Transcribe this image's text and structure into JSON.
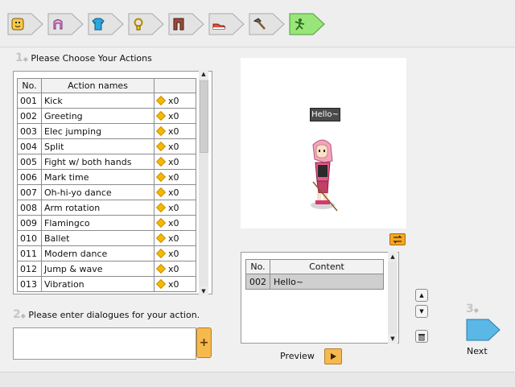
{
  "tabs": [
    {
      "icon": "face-icon"
    },
    {
      "icon": "hair-icon"
    },
    {
      "icon": "shirt-icon"
    },
    {
      "icon": "necklace-icon"
    },
    {
      "icon": "pants-icon"
    },
    {
      "icon": "shoe-icon"
    },
    {
      "icon": "hammer-icon"
    },
    {
      "icon": "dance-icon",
      "active": true
    }
  ],
  "step1": {
    "num": "1",
    "label": "Please Choose Your Actions"
  },
  "actions_table": {
    "headers": [
      "No.",
      "Action names",
      ""
    ],
    "rows": [
      {
        "no": "001",
        "name": "Kick",
        "cost": "x0"
      },
      {
        "no": "002",
        "name": "Greeting",
        "cost": "x0"
      },
      {
        "no": "003",
        "name": "Elec jumping",
        "cost": "x0"
      },
      {
        "no": "004",
        "name": "Split",
        "cost": "x0"
      },
      {
        "no": "005",
        "name": "Fight w/ both hands",
        "cost": "x0"
      },
      {
        "no": "006",
        "name": "Mark time",
        "cost": "x0"
      },
      {
        "no": "007",
        "name": "Oh-hi-yo dance",
        "cost": "x0"
      },
      {
        "no": "008",
        "name": "Arm rotation",
        "cost": "x0"
      },
      {
        "no": "009",
        "name": "Flamingco",
        "cost": "x0"
      },
      {
        "no": "010",
        "name": "Ballet",
        "cost": "x0"
      },
      {
        "no": "011",
        "name": "Modern dance",
        "cost": "x0"
      },
      {
        "no": "012",
        "name": "Jump & wave",
        "cost": "x0"
      },
      {
        "no": "013",
        "name": "Vibration",
        "cost": "x0"
      }
    ]
  },
  "step2": {
    "num": "2",
    "label": "Please enter dialogues for your action."
  },
  "dialog_input": {
    "value": "",
    "plus_label": "+"
  },
  "preview": {
    "bubble_text": "Hello~"
  },
  "content_table": {
    "headers": [
      "No.",
      "Content"
    ],
    "rows": [
      {
        "no": "002",
        "content": "Hello~"
      }
    ]
  },
  "preview_label": "Preview",
  "step3": {
    "num": "3"
  },
  "next_label": "Next",
  "colors": {
    "accent": "#f6b94d",
    "next": "#5ab7e6",
    "active_tab": "#98e57a"
  }
}
